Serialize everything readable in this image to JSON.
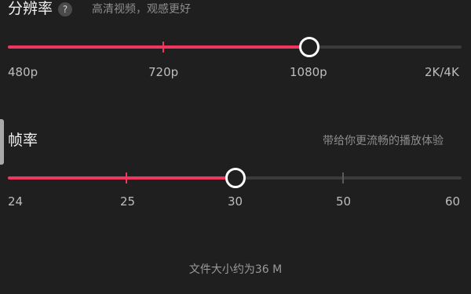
{
  "resolution": {
    "title": "分辨率",
    "help_glyph": "?",
    "description": "高清视频，观感更好",
    "selected_value": "1080p",
    "position_fraction": 0.667,
    "labels": [
      "480p",
      "720p",
      "1080p",
      "2K/4K"
    ]
  },
  "framerate": {
    "title": "帧率",
    "description": "带给你更流畅的播放体验",
    "selected_value": "30",
    "position_fraction": 0.5,
    "labels": [
      "24",
      "25",
      "30",
      "50",
      "60"
    ]
  },
  "footer": {
    "file_size": "文件大小约为36 M"
  },
  "colors": {
    "accent": "#f0365f",
    "track": "#3b3b3b",
    "thumb_border": "#ffffff",
    "background": "#1f1f1f"
  },
  "icons": {
    "help": "question-circle-icon",
    "side_handle": "drag-handle-icon"
  }
}
